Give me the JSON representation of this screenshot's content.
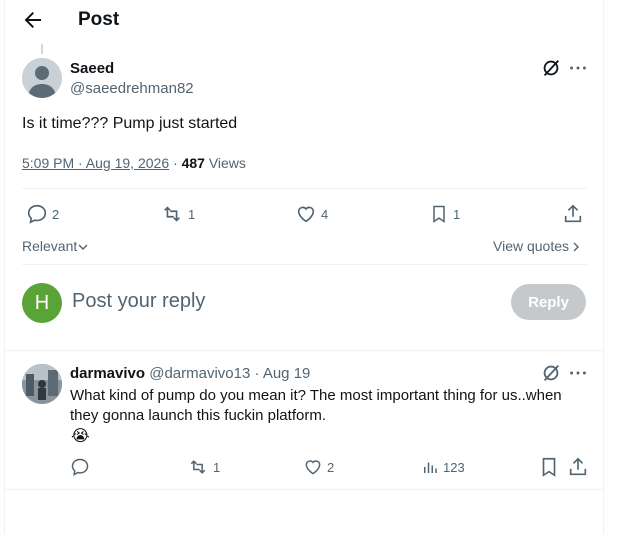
{
  "header": {
    "title": "Post"
  },
  "post": {
    "author_name": "Saeed",
    "author_handle": "@saeedrehman82",
    "text": "Is it time??? Pump just started",
    "timestamp": "5:09 PM · Aug 19, 2026",
    "views_count": "487",
    "views_label": "Views",
    "actions": {
      "replies": "2",
      "reposts": "1",
      "likes": "4",
      "bookmarks": "1"
    }
  },
  "sort": {
    "label": "Relevant",
    "view_quotes": "View quotes"
  },
  "composer": {
    "avatar_letter": "H",
    "placeholder": "Post your reply",
    "reply_label": "Reply"
  },
  "reply": {
    "name": "darmavivo",
    "handle": "@darmavivo13",
    "date": "· Aug 19",
    "text": "What kind of pump do you mean it? The most important thing for us..when they gonna launch this fuckin platform.",
    "emoji": "😭",
    "actions": {
      "replies": "",
      "reposts": "1",
      "likes": "2",
      "views": "123"
    }
  },
  "colors": {
    "reply_button_disabled": "#c5c9cc",
    "avatar_h": "#5aa336",
    "muted": "#536471"
  }
}
